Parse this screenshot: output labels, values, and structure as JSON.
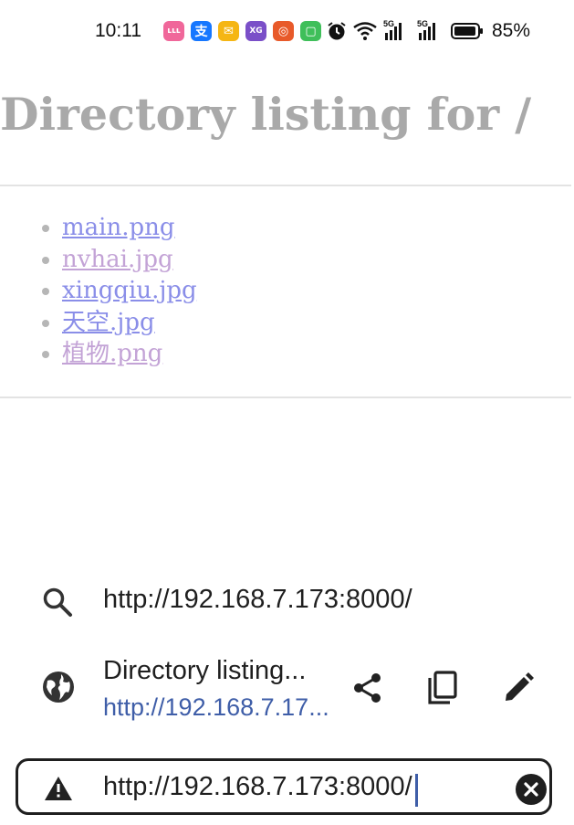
{
  "status_bar": {
    "time": "10:11",
    "apps": [
      {
        "name": "bilibili-app-icon",
        "glyph": "ʟʟʟ",
        "color": "#f0679a"
      },
      {
        "name": "alipay-app-icon",
        "glyph": "支",
        "color": "#1677ff"
      },
      {
        "name": "mail-app-icon",
        "glyph": "✉",
        "color": "#f5b614"
      },
      {
        "name": "app-icon-2",
        "glyph": "XG",
        "color": "#7a4fc8"
      },
      {
        "name": "app-icon-3",
        "glyph": "◎",
        "color": "#e85a2a"
      },
      {
        "name": "messages-app-icon",
        "glyph": "▢",
        "color": "#3fbf5a"
      }
    ],
    "network_1": "5G",
    "network_2": "5G",
    "battery": "85%"
  },
  "page": {
    "title": "Directory listing for /",
    "files": [
      {
        "label": "main.png",
        "state": "unvisited"
      },
      {
        "label": "nvhai.jpg",
        "state": "visited"
      },
      {
        "label": "xingqiu.jpg",
        "state": "unvisited"
      },
      {
        "label": "天空.jpg",
        "state": "unvisited"
      },
      {
        "label": "植物.png",
        "state": "visited"
      }
    ]
  },
  "omnibox": {
    "search_suggestion": "http://192.168.7.173:8000/",
    "page_suggestion_title": "Directory listing...",
    "page_suggestion_url": "http://192.168.7.17...",
    "url_value": "http://192.168.7.173:8000/"
  },
  "colors": {
    "link_unvisited": "#8a8ee8",
    "link_visited": "#c3a3d6",
    "heading": "#a9a9a9",
    "url_blue": "#3f5ea8"
  }
}
